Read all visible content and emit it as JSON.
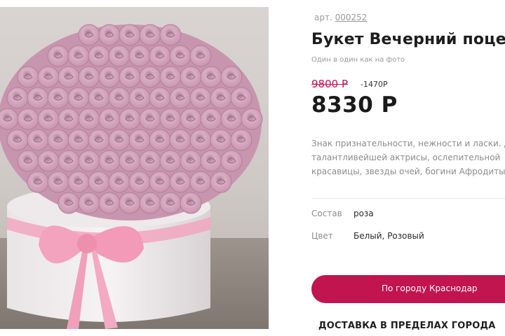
{
  "product": {
    "image_alt": "Букет Вечерний поцелуй",
    "sku_label": "арт.",
    "sku_value": "000252",
    "title": "Букет Вечерний поце",
    "subtitle": "Один в один как на фото",
    "old_price": "9800 Р",
    "discount": "-1470Р",
    "price": "8330 Р",
    "description": [
      "Знак признательности, нежности и ласки. Д",
      "талантливейшей актрисы, ослепительной",
      "красавицы, звезды очей, богини Афродиты"
    ],
    "specs": [
      {
        "label": "Состав",
        "value": "роза"
      },
      {
        "label": "Цвет",
        "value": "Белый, Розовый"
      }
    ]
  },
  "delivery": {
    "city_button_label": "По городу Краснодар",
    "heading": "ДОСТАВКА В ПРЕДЕЛАХ ГОРОДА"
  },
  "colors": {
    "accent": "#c2144f",
    "old_price": "#c9104e",
    "muted_text": "#8c8c8c"
  }
}
